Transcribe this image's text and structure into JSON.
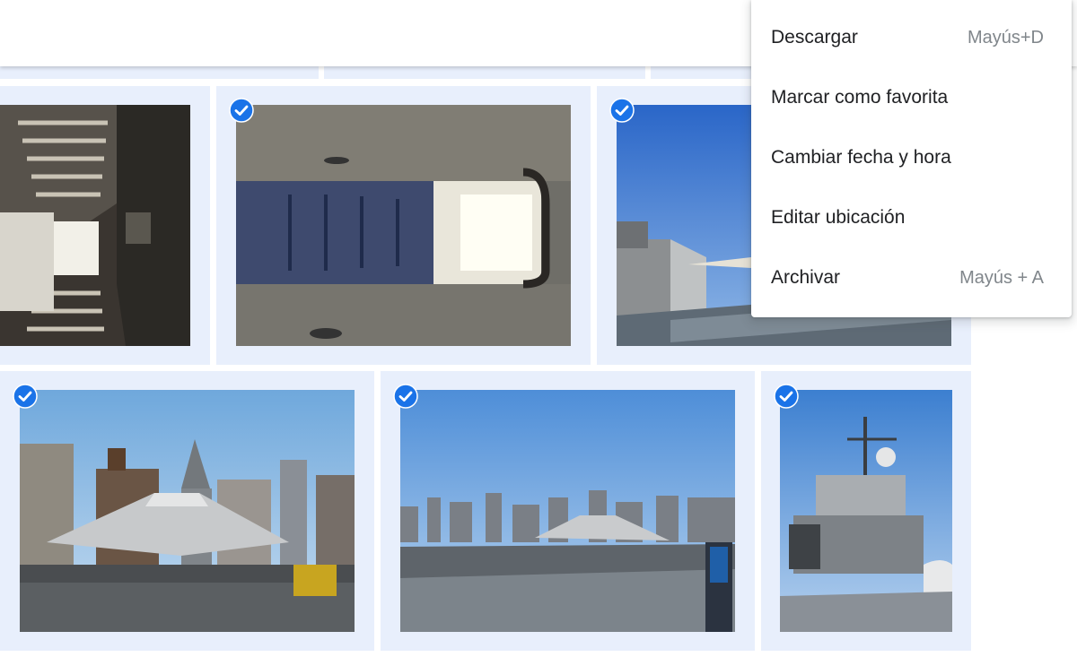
{
  "menu": {
    "items": [
      {
        "label": "Descargar",
        "shortcut": "Mayús+D"
      },
      {
        "label": "Marcar como favorita",
        "shortcut": ""
      },
      {
        "label": "Cambiar fecha y hora",
        "shortcut": ""
      },
      {
        "label": "Editar ubicación",
        "shortcut": ""
      },
      {
        "label": "Archivar",
        "shortcut": "Mayús + A"
      }
    ]
  },
  "photos": [
    {
      "subject": "corridor-interior",
      "selected": false
    },
    {
      "subject": "airplane-cabin-interior",
      "selected": true
    },
    {
      "subject": "flight-deck-concorde",
      "selected": true
    },
    {
      "subject": "stealth-aircraft-skyline",
      "selected": true
    },
    {
      "subject": "flight-deck-panorama",
      "selected": true
    },
    {
      "subject": "carrier-island-tower",
      "selected": true
    }
  ],
  "colors": {
    "accent": "#1a73e8",
    "tile_background": "#e8effc",
    "menu_text": "#202124",
    "shortcut_text": "#80868b"
  }
}
